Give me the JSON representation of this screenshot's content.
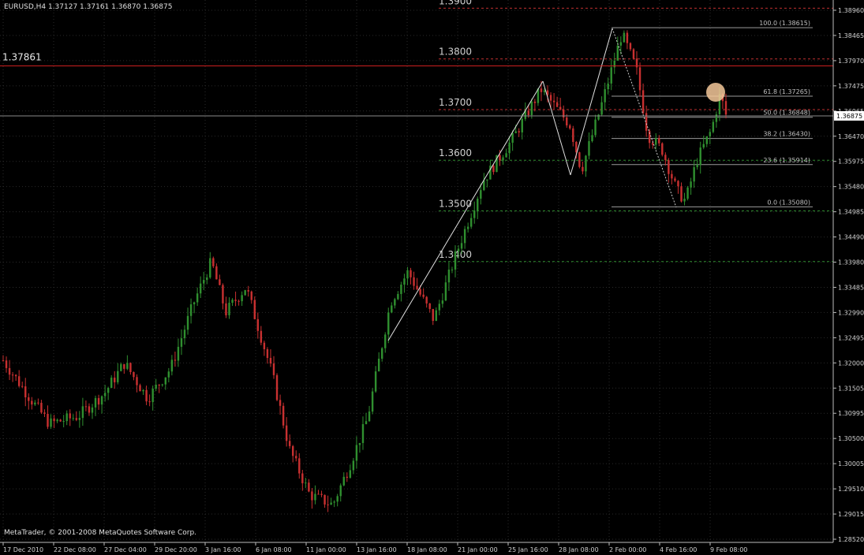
{
  "header": {
    "symbol_text": "EURUSD,H4  1.37127 1.37161 1.36870 1.36875"
  },
  "footer": {
    "copyright": "MetaTrader, © 2001-2008 MetaQuotes Software Corp."
  },
  "chart_data": {
    "type": "candlestick",
    "symbol": "EURUSD",
    "timeframe": "H4",
    "ohlc_last": {
      "open": 1.37127,
      "high": 1.37161,
      "low": 1.3687,
      "close": 1.36875
    },
    "current_price": 1.36875,
    "ylim": [
      1.2852,
      1.3896
    ],
    "y_ticks": [
      "1.38960",
      "1.38465",
      "1.37970",
      "1.37475",
      "1.36965",
      "1.36470",
      "1.35975",
      "1.35480",
      "1.34985",
      "1.34490",
      "1.33980",
      "1.33485",
      "1.32990",
      "1.32495",
      "1.32000",
      "1.31505",
      "1.30995",
      "1.30500",
      "1.30005",
      "1.29510",
      "1.29015",
      "1.28520"
    ],
    "x_ticks": [
      "17 Dec 2010",
      "22 Dec 08:00",
      "27 Dec 04:00",
      "29 Dec 20:00",
      "3 Jan 16:00",
      "6 Jan 08:00",
      "11 Jan 00:00",
      "13 Jan 16:00",
      "18 Jan 08:00",
      "21 Jan 00:00",
      "25 Jan 16:00",
      "28 Jan 08:00",
      "2 Feb 00:00",
      "4 Feb 16:00",
      "9 Feb 08:00"
    ],
    "horizontal_line": {
      "price": 1.37861,
      "label": "1.37861",
      "color": "#d02020"
    },
    "round_levels": [
      {
        "price": 1.39,
        "label": "1.3900",
        "color": "#c03030"
      },
      {
        "price": 1.38,
        "label": "1.3800",
        "color": "#c03030"
      },
      {
        "price": 1.37,
        "label": "1.3700",
        "color": "#c03030"
      },
      {
        "price": 1.36,
        "label": "1.3600",
        "color": "#2e8b2e"
      },
      {
        "price": 1.35,
        "label": "1.3500",
        "color": "#2e8b2e"
      },
      {
        "price": 1.34,
        "label": "1.3400",
        "color": "#2e8b2e"
      }
    ],
    "fibonacci": [
      {
        "label": "100.0 (1.38615)",
        "price": 1.38615
      },
      {
        "label": "61.8 (1.37265)",
        "price": 1.37265
      },
      {
        "label": "50.0 (1.36848)",
        "price": 1.36848
      },
      {
        "label": "38.2 (1.36430)",
        "price": 1.3643
      },
      {
        "label": "23.6 (1.35914)",
        "price": 1.35914
      },
      {
        "label": "0.0 (1.35080)",
        "price": 1.3508
      }
    ],
    "candle_count": 228,
    "colors": {
      "bull": "#2f8f2f",
      "bear": "#c83030",
      "bg": "#000000",
      "grid": "#2a2a2a"
    }
  }
}
